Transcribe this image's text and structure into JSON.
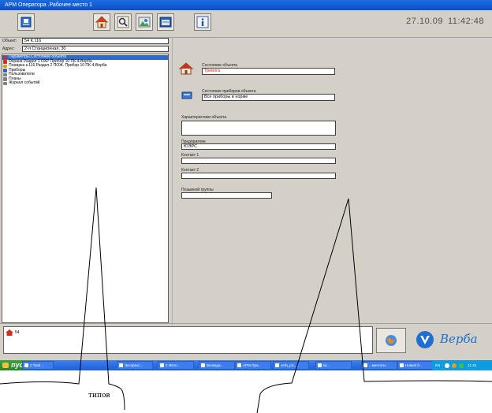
{
  "window": {
    "title": "АРМ Оператора .Рабочее место 1"
  },
  "header": {
    "date": "27.10.09",
    "time": "11:42:48"
  },
  "toolbar": {
    "buttons": [
      "export-icon",
      "home-icon",
      "search-icon",
      "image-icon",
      "window-icon",
      "info-icon"
    ]
  },
  "left": {
    "object_label": "Объект:",
    "object_value": "54  К.116",
    "address_label": "Адрес:",
    "address_value": "2-я Станционная, 30",
    "tree": [
      {
        "label": "Параметры,Состояние объекта",
        "selected": true,
        "icon_color": "#d03020"
      },
      {
        "label": "Охрана  Раздел 1  ОХР   Прибор 10  ПК-4-Верба",
        "selected": false,
        "icon_color": "#d03020"
      },
      {
        "label": "Пожарка к.116  Раздел 2  ПОЖ.  Прибор 10  ПК-4-Верба",
        "selected": false,
        "icon_color": "#e0a000"
      },
      {
        "label": "Приборы",
        "selected": false,
        "icon_color": "#3060c0"
      },
      {
        "label": "Пользователи",
        "selected": false,
        "icon_color": "#808080"
      },
      {
        "label": "Планы",
        "selected": false,
        "icon_color": "#808080"
      },
      {
        "label": "Журнал событий",
        "selected": false,
        "icon_color": "#808080"
      }
    ]
  },
  "right": {
    "object_state_label": "Состояние объекта",
    "object_state_value": "Тревога",
    "device_state_label": "Состояние приборов объекта",
    "device_state_value": "Все приборы в норме",
    "characteristics_label": "Характеристики объекта",
    "characteristics_value": "",
    "enterprise_label": "Предприятие",
    "enterprise_value": "ЮЭРС",
    "contact1_label": "Контакт 1",
    "contact1_value": "",
    "contact2_label": "Контакт 2",
    "contact2_value": "",
    "callsign_label": "Позывной группы",
    "callsign_value": ""
  },
  "bottom": {
    "event_text": "54",
    "logo_text": "Верба"
  },
  "taskbar": {
    "start_label": "пуск",
    "tasks": [
      "2 Total ...",
      "Экспресс...",
      "2 Micro...",
      "Велкада...",
      "АРМ Ора...",
      "verb_pic_...",
      "Ш...",
      "...ментати...",
      "Новый б..."
    ],
    "tray_lang": "EN",
    "tray_time": "11:42"
  },
  "annotation": {
    "caption": "типов"
  },
  "colors": {
    "alarm": "#d02020",
    "accent": "#316ac5",
    "logo": "#1e6fd0"
  }
}
